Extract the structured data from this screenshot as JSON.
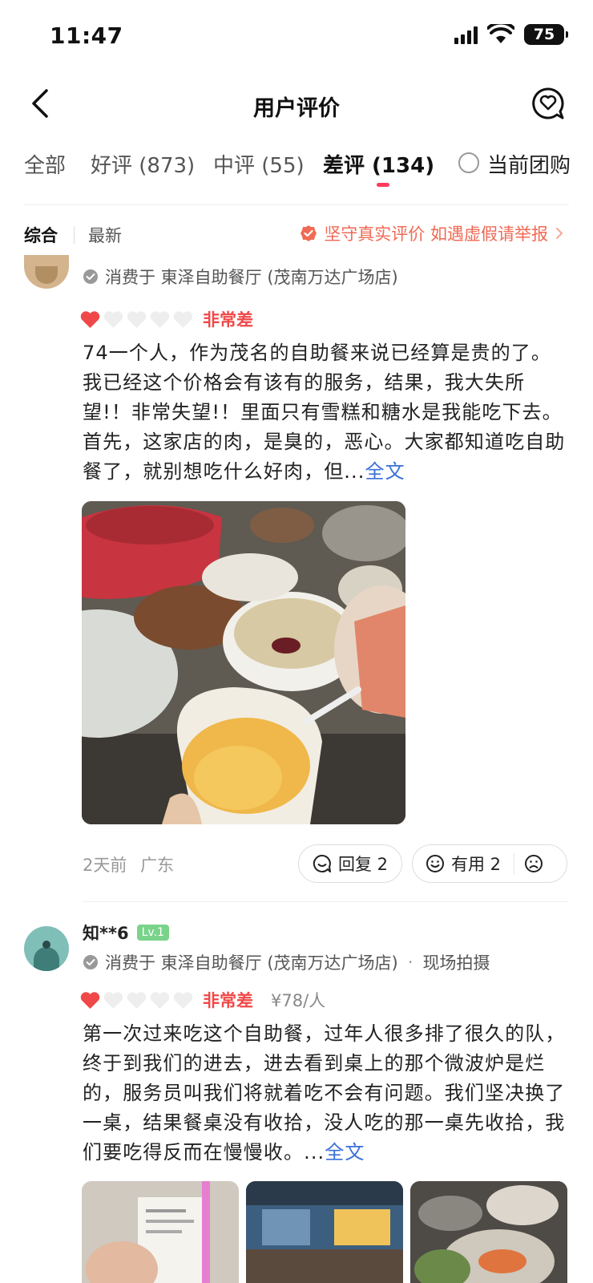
{
  "status": {
    "time": "11:47",
    "battery": "75"
  },
  "nav": {
    "title": "用户评价"
  },
  "tabs": {
    "all": "全部",
    "good": "好评 (873)",
    "mid": "中评 (55)",
    "bad": "差评 (134)",
    "current_deal": "当前团购"
  },
  "sort": {
    "comprehensive": "综合",
    "latest": "最新",
    "notice": "坚守真实评价 如遇虚假请举报"
  },
  "reviews": [
    {
      "consume": "消费于 東泽自助餐厅 (茂南万达广场店)",
      "rating_text": "非常差",
      "stars": 1,
      "text": "74一个人，作为茂名的自助餐来说已经算是贵的了。我已经这个价格会有该有的服务，结果，我大失所望!！非常失望!！里面只有雪糕和糖水是我能吃下去。首先，这家店的肉，是臭的，恶心。大家都知道吃自助餐了，就别想吃什么好肉，但...",
      "more": "全文",
      "time": "2天前",
      "location": "广东",
      "reply": "回复 2",
      "useful": "有用 2"
    },
    {
      "user": "知**6",
      "level": "Lv.1",
      "consume": "消费于 東泽自助餐厅 (茂南万达广场店)",
      "tag": "现场拍摄",
      "rating_text": "非常差",
      "stars": 1,
      "price": "¥78/人",
      "text": "第一次过来吃这个自助餐，过年人很多排了很久的队，终于到我们的进去，进去看到桌上的那个微波炉是烂的，服务员叫我们将就着吃不会有问题。我们坚决换了一桌，结果餐桌没有收拾，没人吃的那一桌先收拾，我们要吃得反而在慢慢收。...",
      "more": "全文"
    }
  ],
  "colors": {
    "accent": "#ff3b5c",
    "rating": "#f04848",
    "link": "#3a6fd8"
  }
}
